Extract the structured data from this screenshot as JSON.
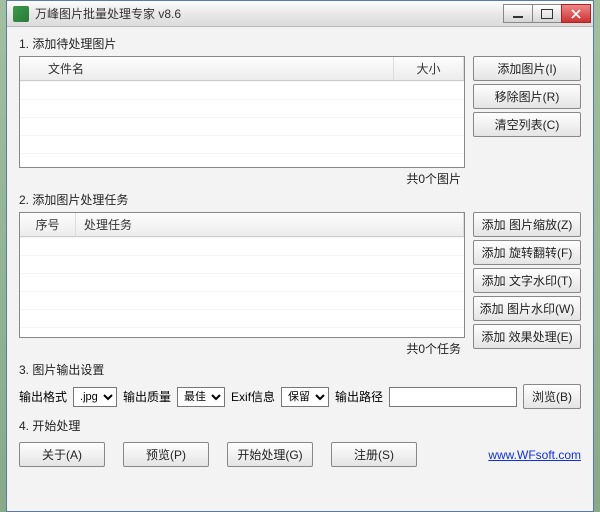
{
  "window": {
    "title": "万峰图片批量处理专家 v8.6"
  },
  "section1": {
    "label": "1. 添加待处理图片",
    "col_filename": "文件名",
    "col_size": "大小",
    "count": "共0个图片",
    "btn_add": "添加图片(I)",
    "btn_remove": "移除图片(R)",
    "btn_clear": "清空列表(C)"
  },
  "section2": {
    "label": "2. 添加图片处理任务",
    "col_index": "序号",
    "col_task": "处理任务",
    "count": "共0个任务",
    "btn_resize": "添加 图片缩放(Z)",
    "btn_rotate": "添加 旋转翻转(F)",
    "btn_textwm": "添加 文字水印(T)",
    "btn_imgwm": "添加 图片水印(W)",
    "btn_effect": "添加 效果处理(E)"
  },
  "section3": {
    "label": "3. 图片输出设置",
    "out_format_label": "输出格式",
    "out_format_value": ".jpg",
    "out_quality_label": "输出质量",
    "out_quality_value": "最佳",
    "exif_label": "Exif信息",
    "exif_value": "保留",
    "out_path_label": "输出路径",
    "out_path_value": "",
    "browse": "浏览(B)"
  },
  "section4": {
    "label": "4. 开始处理",
    "about": "关于(A)",
    "preview": "预览(P)",
    "start": "开始处理(G)",
    "register": "注册(S)",
    "link": "www.WFsoft.com"
  }
}
